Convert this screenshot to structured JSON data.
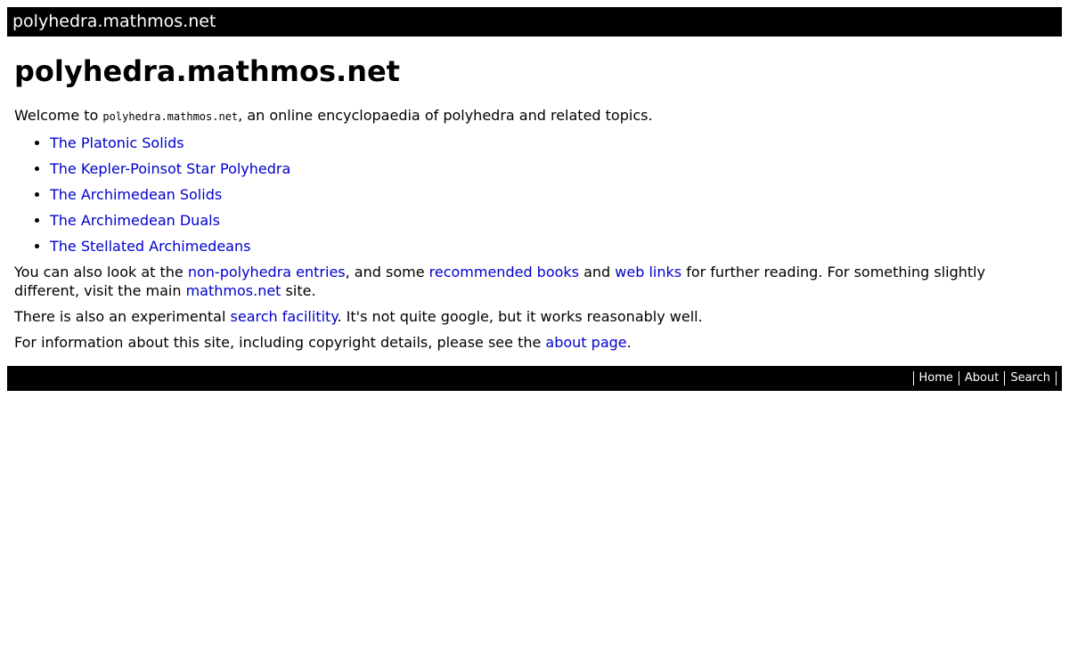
{
  "header": {
    "site_title": "polyhedra.mathmos.net"
  },
  "main": {
    "heading": "polyhedra.mathmos.net",
    "welcome_prefix": "Welcome to ",
    "welcome_site": "polyhedra.mathmos.net",
    "welcome_suffix": ", an online encyclopaedia of polyhedra and related topics.",
    "links": [
      {
        "label": "The Platonic Solids"
      },
      {
        "label": "The Kepler-Poinsot Star Polyhedra"
      },
      {
        "label": "The Archimedean Solids"
      },
      {
        "label": "The Archimedean Duals"
      },
      {
        "label": "The Stellated Archimedeans"
      }
    ],
    "para2": {
      "t1": "You can also look at the ",
      "link1": "non-polyhedra entries",
      "t2": ", and some ",
      "link2": "recommended books",
      "t3": " and ",
      "link3": "web links",
      "t4": " for further reading. For something slightly different, visit the main ",
      "link4": "mathmos.net",
      "t5": " site."
    },
    "para3": {
      "t1": "There is also an experimental ",
      "link1": "search facilitity",
      "t2": ". It's not quite google, but it works reasonably well."
    },
    "para4": {
      "t1": "For information about this site, including copyright details, please see the ",
      "link1": "about page",
      "t2": "."
    }
  },
  "footer": {
    "nav": [
      {
        "label": "Home"
      },
      {
        "label": "About"
      },
      {
        "label": "Search"
      }
    ]
  },
  "colors": {
    "link": "#0000cc",
    "bar_background": "#000000",
    "bar_text": "#ffffff"
  }
}
